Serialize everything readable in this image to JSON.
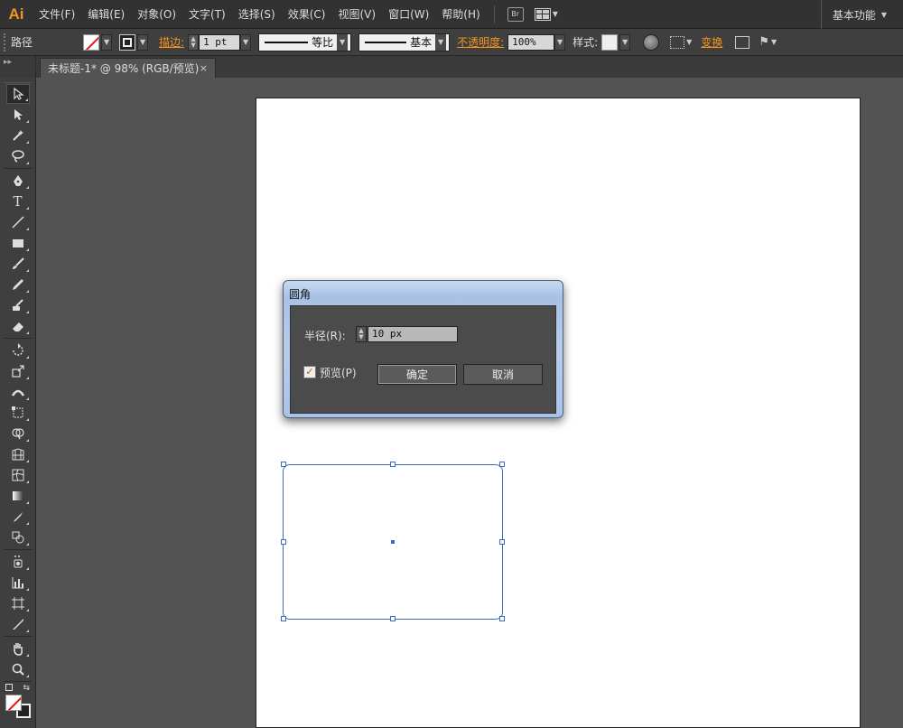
{
  "app": {
    "logo": "Ai"
  },
  "menu": {
    "items": [
      "文件(F)",
      "编辑(E)",
      "对象(O)",
      "文字(T)",
      "选择(S)",
      "效果(C)",
      "视图(V)",
      "窗口(W)",
      "帮助(H)"
    ],
    "bridge_label": "Br",
    "workspace": "基本功能"
  },
  "control": {
    "selection_label": "路径",
    "stroke_link": "描边:",
    "stroke_weight": "1 pt",
    "profile": "等比",
    "brush": "基本",
    "opacity_link": "不透明度:",
    "opacity": "100%",
    "style_label": "样式:",
    "transform_link": "变换"
  },
  "document": {
    "tab_title": "未标题-1* @ 98% (RGB/预览)",
    "close_glyph": "×"
  },
  "dialog": {
    "title": "圆角",
    "radius_label": "半径(R):",
    "radius_value": "10 px",
    "preview_label": "预览(P)",
    "preview_checked": true,
    "ok_label": "确定",
    "cancel_label": "取消"
  },
  "colors": {
    "accent": "#f7941d",
    "selection": "#3b6bbf",
    "ui_dark": "#535353"
  }
}
